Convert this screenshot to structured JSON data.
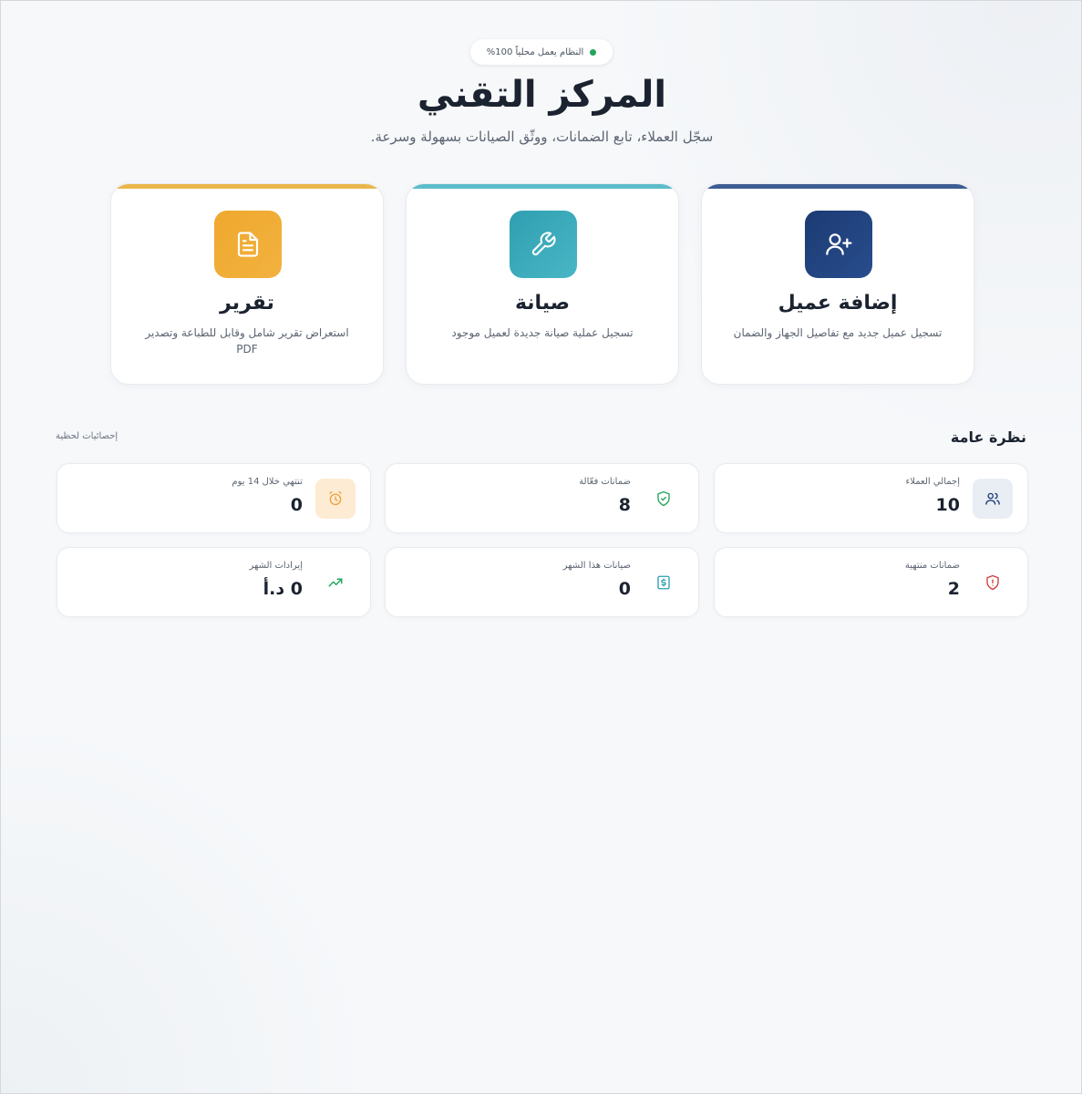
{
  "header": {
    "status": "النظام يعمل محلياً 100%",
    "title": "المركز التقني",
    "subtitle": "سجّل العملاء، تابع الضمانات، ووثّق الصيانات بسهولة وسرعة."
  },
  "actions": [
    {
      "title": "إضافة عميل",
      "description": "تسجيل عميل جديد مع تفاصيل الجهاز والضمان",
      "icon": "user-plus-icon",
      "color": "#1c3b74"
    },
    {
      "title": "صيانة",
      "description": "تسجيل عملية صيانة جديدة لعميل موجود",
      "icon": "wrench-icon",
      "color": "#2f9fb1"
    },
    {
      "title": "تقرير",
      "description": "استعراض تقرير شامل وقابل للطباعة وتصدير PDF",
      "icon": "document-icon",
      "color": "#efa82e"
    }
  ],
  "overview": {
    "title": "نظرة عامة",
    "note": "إحصائيات لحظية",
    "stats": [
      {
        "label": "إجمالي العملاء",
        "value": "10",
        "icon": "users-icon",
        "color": "#1c3b74"
      },
      {
        "label": "ضمانات فعّالة",
        "value": "8",
        "icon": "shield-check-icon",
        "color": "#22a55a"
      },
      {
        "label": "تنتهي خلال 14 يوم",
        "value": "0",
        "icon": "alarm-clock-icon",
        "color": "#e8a33a"
      },
      {
        "label": "ضمانات منتهية",
        "value": "2",
        "icon": "shield-alert-icon",
        "color": "#d23c3c"
      },
      {
        "label": "صيانات هذا الشهر",
        "value": "0",
        "icon": "dollar-receipt-icon",
        "color": "#2f9fb1"
      },
      {
        "label": "إيرادات الشهر",
        "value": "0 د.أ",
        "icon": "trending-up-icon",
        "color": "#22a55a"
      }
    ]
  }
}
